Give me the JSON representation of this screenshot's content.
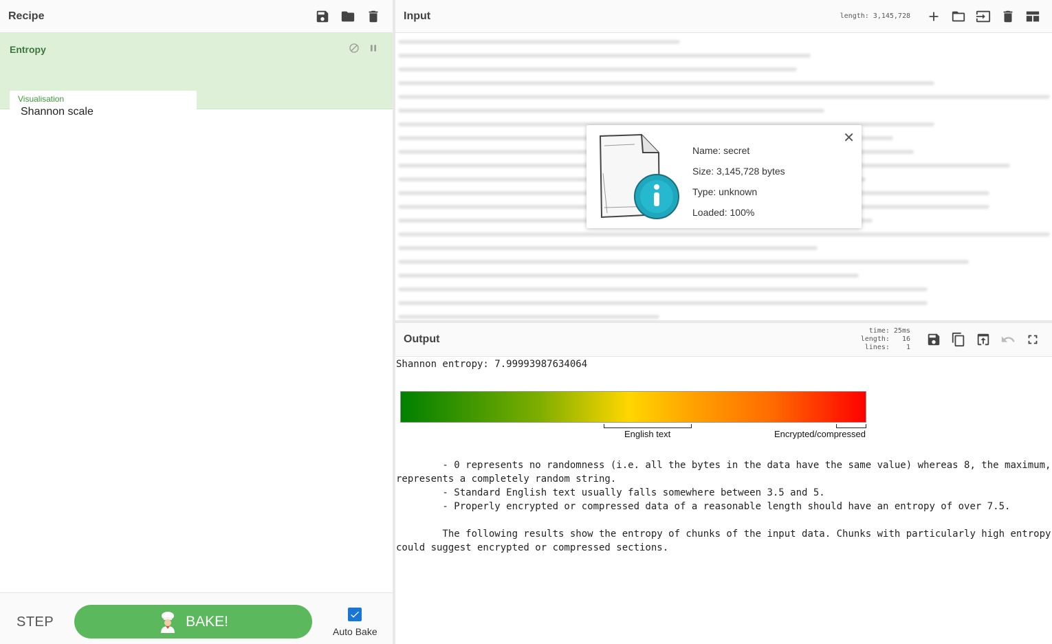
{
  "recipe": {
    "title": "Recipe",
    "toolbar": {
      "save_icon": "save-icon",
      "load_icon": "folder-icon",
      "clear_icon": "trash-icon"
    },
    "operation": {
      "name": "Entropy",
      "arg_label": "Visualisation",
      "arg_value": "Shannon scale"
    },
    "controls": {
      "step_label": "STEP",
      "bake_label": "BAKE!",
      "autobake_label": "Auto Bake",
      "autobake_checked": true
    }
  },
  "input": {
    "title": "Input",
    "length_label": "length: 3,145,728"
  },
  "file_info": {
    "name": "Name: secret",
    "size": "Size: 3,145,728 bytes",
    "type": "Type: unknown",
    "loaded": "Loaded: 100%"
  },
  "output": {
    "title": "Output",
    "time": "time: 25ms",
    "length": "length:   16",
    "lines": "lines:    1",
    "entropy_text": "Shannon entropy: 7.99993987634064",
    "scale_label_english": "English text",
    "scale_label_encrypted": "Encrypted/compressed",
    "explanation": "        - 0 represents no randomness (i.e. all the bytes in the data have the same value) whereas 8, the maximum,\nrepresents a completely random string.\n        - Standard English text usually falls somewhere between 3.5 and 5.\n        - Properly encrypted or compressed data of a reasonable length should have an entropy of over 7.5.\n\n        The following results show the entropy of chunks of the input data. Chunks with particularly high entropy\ncould suggest encrypted or compressed sections."
  },
  "colors": {
    "accent_green": "#5cb85c",
    "op_bg": "#dff0d8",
    "op_text": "#3c763d",
    "checkbox_blue": "#1976d2"
  }
}
